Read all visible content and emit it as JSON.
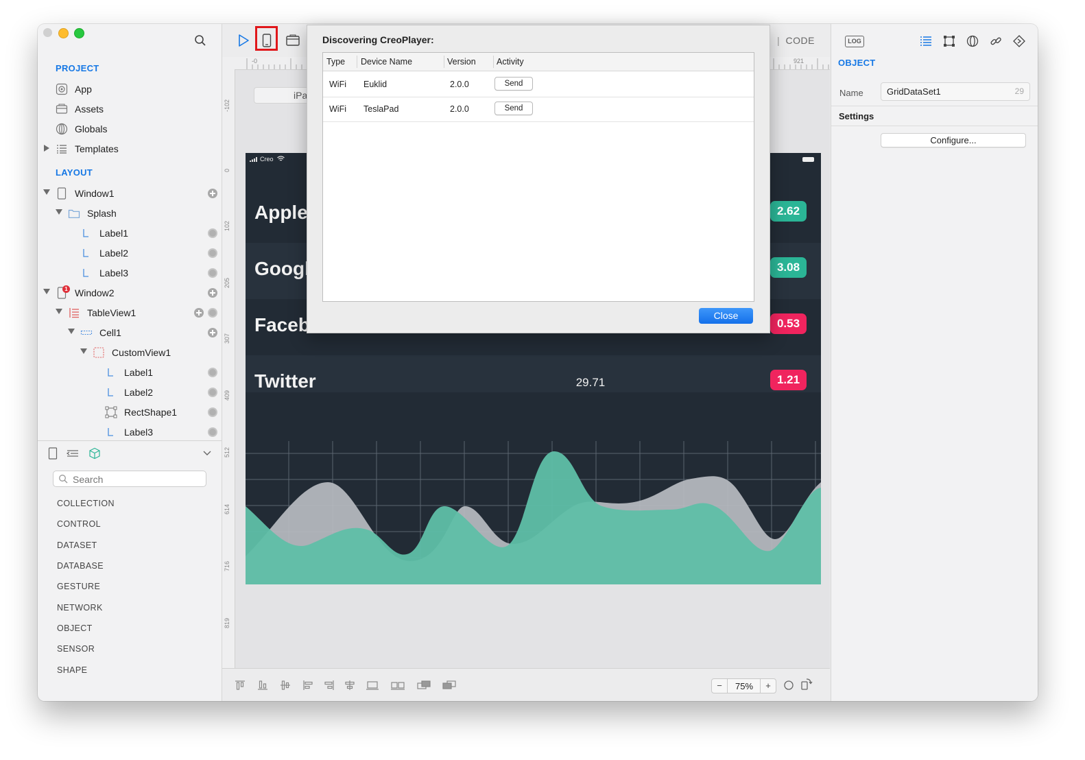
{
  "project": {
    "section_title": "PROJECT",
    "items": [
      {
        "label": "App"
      },
      {
        "label": "Assets"
      },
      {
        "label": "Globals"
      },
      {
        "label": "Templates"
      }
    ]
  },
  "layout": {
    "section_title": "LAYOUT",
    "items": [
      {
        "label": "Window1"
      },
      {
        "label": "Splash"
      },
      {
        "label": "Label1"
      },
      {
        "label": "Label2"
      },
      {
        "label": "Label3"
      },
      {
        "label": "Window2",
        "badge": "1"
      },
      {
        "label": "TableView1"
      },
      {
        "label": "Cell1"
      },
      {
        "label": "CustomView1"
      },
      {
        "label": "Label1"
      },
      {
        "label": "Label2"
      },
      {
        "label": "RectShape1"
      },
      {
        "label": "Label3"
      }
    ]
  },
  "library": {
    "search_placeholder": "Search",
    "categories": [
      "COLLECTION",
      "CONTROL",
      "DATASET",
      "DATABASE",
      "GESTURE",
      "NETWORK",
      "OBJECT",
      "SENSOR",
      "SHAPE"
    ]
  },
  "toolbar": {
    "tab_design_visible": "N",
    "separator": "|",
    "tab_code": "CODE"
  },
  "rulers": {
    "h_start": "-0",
    "h_end": "921",
    "v_labels": [
      "-102",
      "0",
      "102",
      "205",
      "307",
      "409",
      "512",
      "614",
      "716",
      "819",
      "921"
    ]
  },
  "canvas": {
    "device_chip": "iPa",
    "status_carrier": "Creo",
    "rows": [
      {
        "name": "Apple",
        "value": "",
        "badge": "2.62",
        "badge_color": "#2bb596"
      },
      {
        "name": "Googl",
        "value": "",
        "badge": "3.08",
        "badge_color": "#2bb596"
      },
      {
        "name": "Facebook",
        "value": "",
        "badge": "0.53",
        "badge_color": "#f0245e"
      },
      {
        "name": "Twitter",
        "value": "29.71",
        "badge": "1.21",
        "badge_color": "#f0245e"
      }
    ]
  },
  "zoom": {
    "minus": "−",
    "value": "75%",
    "plus": "+"
  },
  "inspector": {
    "log_label": "LOG",
    "object_title": "OBJECT",
    "name_label": "Name",
    "name_value": "GridDataSet1",
    "name_count": "29",
    "settings_label": "Settings",
    "configure_label": "Configure..."
  },
  "dialog": {
    "title": "Discovering CreoPlayer:",
    "columns": [
      "Type",
      "Device Name",
      "Version",
      "Activity"
    ],
    "rows": [
      {
        "type": "WiFi",
        "device": "Euklid",
        "version": "2.0.0",
        "action": "Send"
      },
      {
        "type": "WiFi",
        "device": "TeslaPad",
        "version": "2.0.0",
        "action": "Send"
      }
    ],
    "close_label": "Close"
  },
  "colors": {
    "accent": "#1678e5",
    "highlight": "#e0171b",
    "device_bg": "#222b35",
    "teal": "#2bb596",
    "pink": "#f0245e"
  }
}
